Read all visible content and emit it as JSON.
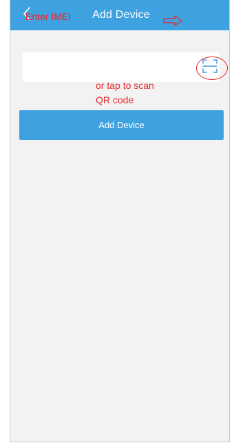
{
  "header": {
    "title": "Add Device",
    "back_icon": "chevron-left-icon"
  },
  "imei_field": {
    "value": "",
    "placeholder": "",
    "scan_icon": "qr-scan-icon"
  },
  "annotations": {
    "enter_imei": "Enter IMEI",
    "scan_line1": "or tap to scan",
    "scan_line2": "QR code",
    "arrow_icon": "arrow-right-outline-icon",
    "color": "#e8252b"
  },
  "actions": {
    "add_device_label": "Add Device"
  },
  "colors": {
    "accent": "#3fa2e0",
    "background": "#f2f2f2",
    "annotation": "#e8252b"
  }
}
